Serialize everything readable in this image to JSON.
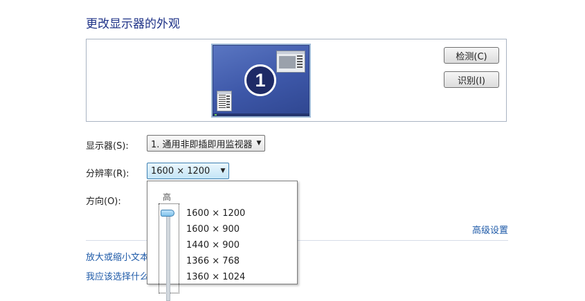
{
  "title": "更改显示器的外观",
  "preview": {
    "monitor_number": "1",
    "detect_button": "检测(C)",
    "identify_button": "识别(I)"
  },
  "display": {
    "label": "显示器(S):",
    "value": "1. 通用非即插即用监视器"
  },
  "resolution": {
    "label": "分辨率(R):",
    "value": "1600 × 1200",
    "dropdown_high_label": "高",
    "options": [
      "1600 × 1200",
      "1600 × 900",
      "1440 × 900",
      "1366 × 768",
      "1360 × 1024"
    ]
  },
  "orientation": {
    "label": "方向(O):"
  },
  "advanced_link": "高级设置",
  "links": [
    "放大或缩小文本",
    "我应该选择什么"
  ],
  "colors": {
    "title": "#1e3287",
    "link": "#1e5aa8",
    "monitor_bg": "#3d57a8"
  }
}
